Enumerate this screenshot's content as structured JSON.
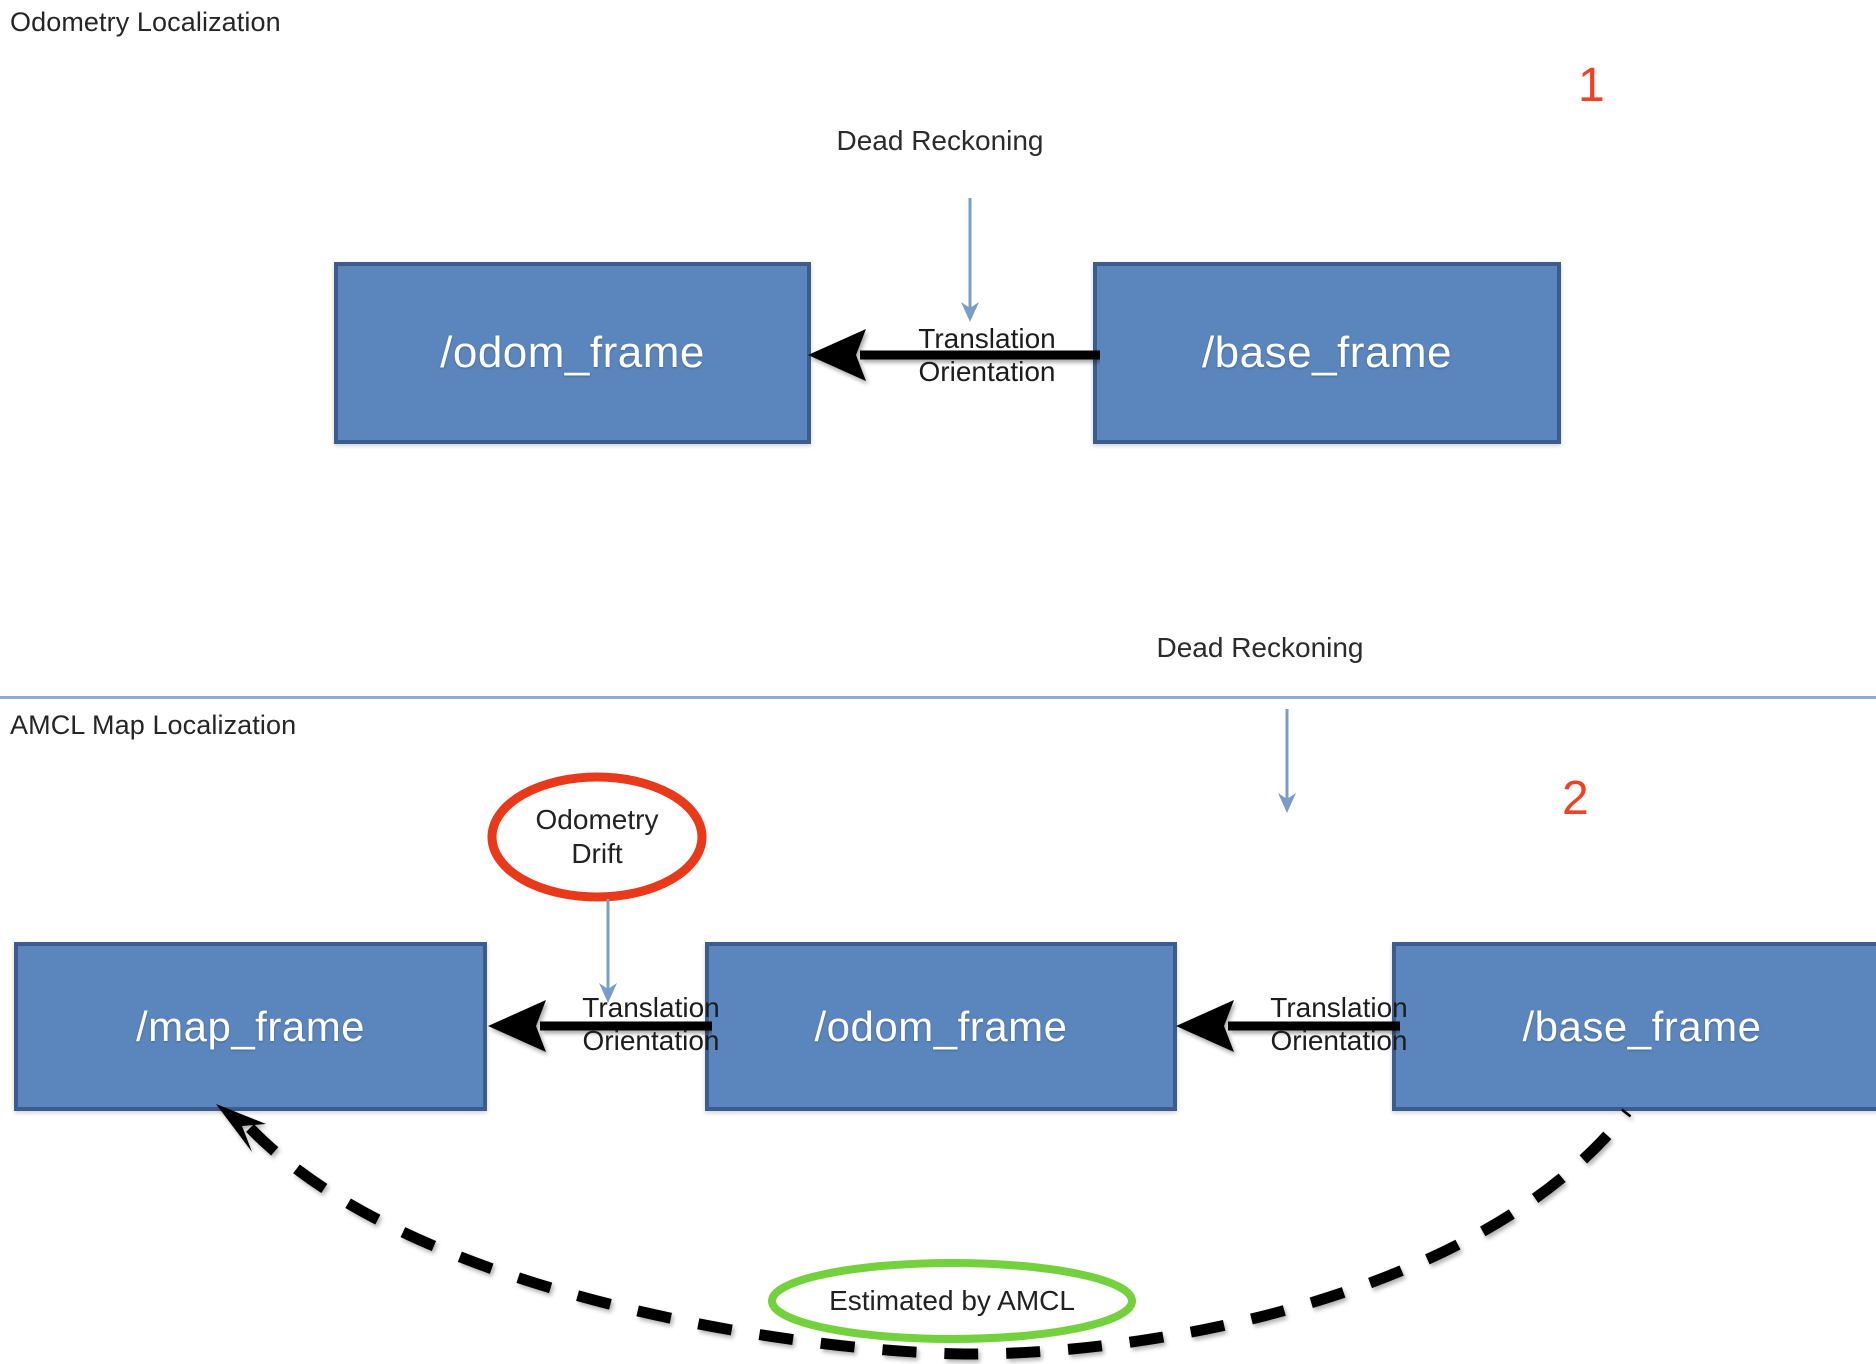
{
  "page": {
    "background": "#ffffff",
    "box_fill": "#5b86bd",
    "box_border": "#3b5c8c",
    "step_number_color": "#ef4123",
    "divider_color": "#8fa9d4",
    "red_ellipse_color": "#e8391b",
    "green_ellipse_color": "#73d13d",
    "arrow_color": "#000000",
    "annotation_arrow_color": "#7a9cc6"
  },
  "panels": [
    {
      "id": "odometry-localization",
      "title": "Odometry Localization",
      "step_number": "1",
      "boxes": [
        {
          "id": "odom-frame",
          "label": "/odom_frame"
        },
        {
          "id": "base-frame",
          "label": "/base_frame"
        }
      ],
      "annotations": [
        {
          "id": "dead-reckoning",
          "line1": "Dead",
          "line2": "Reckoning"
        }
      ],
      "transforms": [
        {
          "id": "base-to-odom",
          "line1": "Translation",
          "line2": "Orientation"
        }
      ]
    },
    {
      "id": "amcl-map-localization",
      "title": "AMCL Map Localization",
      "step_number": "2",
      "boxes": [
        {
          "id": "map-frame",
          "label": "/map_frame"
        },
        {
          "id": "odom-frame",
          "label": "/odom_frame"
        },
        {
          "id": "base-frame",
          "label": "/base_frame"
        }
      ],
      "annotations": [
        {
          "id": "odometry-drift",
          "line1": "Odometry",
          "line2": "Drift"
        },
        {
          "id": "dead-reckoning",
          "line1": "Dead",
          "line2": "Reckoning"
        }
      ],
      "transforms": [
        {
          "id": "odom-to-map",
          "line1": "Translation",
          "line2": "Orientation"
        },
        {
          "id": "base-to-odom",
          "line1": "Translation",
          "line2": "Orientation"
        }
      ],
      "amcl_estimate": {
        "id": "estimated-by-amcl",
        "label": "Estimated by AMCL"
      }
    }
  ]
}
